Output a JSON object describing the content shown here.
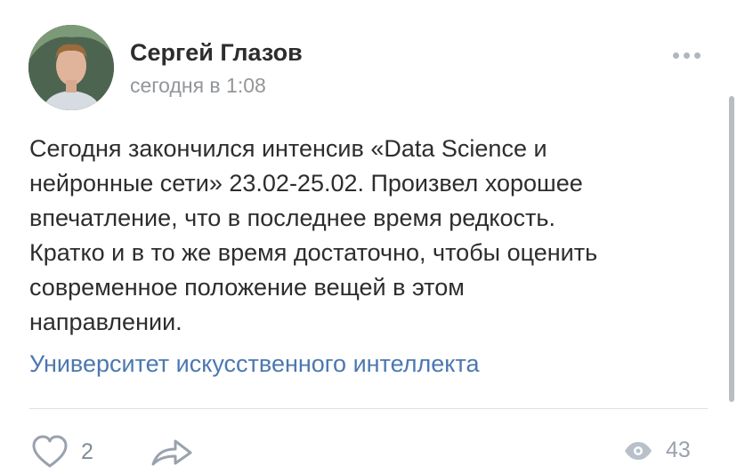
{
  "post": {
    "author_name": "Сергей Глазов",
    "timestamp": "сегодня в 1:08",
    "text_lines": [
      "Сегодня закончился интенсив «Data Science и",
      "нейронные сети» 23.02-25.02. Произвел хорошее",
      "впечатление, что в последнее время редкость.",
      "Кратко и в то же время достаточно, чтобы оценить",
      "современное положение вещей в этом",
      "направлении."
    ],
    "source_link": "Университет искусственного интеллекта"
  },
  "actions": {
    "likes": "2",
    "views": "43"
  },
  "icons": {
    "like": "heart-outline-icon",
    "share": "share-arrow-icon",
    "views": "eye-icon",
    "more": "more-dots-icon"
  },
  "colors": {
    "text": "#2c2d2e",
    "secondary": "#939699",
    "link": "#4b78b0",
    "icon": "#99a2ad"
  }
}
